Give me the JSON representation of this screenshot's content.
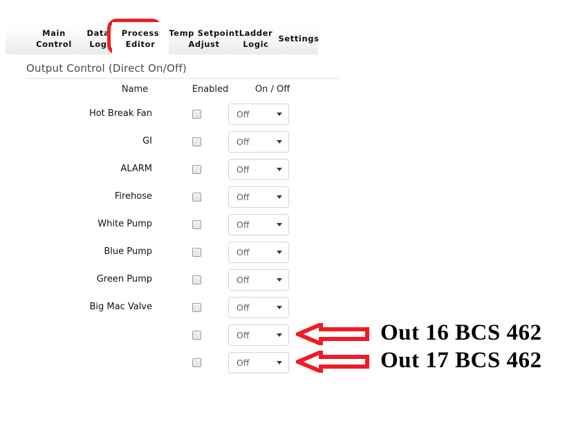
{
  "tabs": [
    {
      "id": "main",
      "line1": "Main",
      "line2": "Control",
      "name": "tab-main-control",
      "highlighted": false
    },
    {
      "id": "datalog",
      "line1": "Data",
      "line2": "Log",
      "name": "tab-data-log",
      "highlighted": false
    },
    {
      "id": "process",
      "line1": "Process",
      "line2": "Editor",
      "name": "tab-process-editor",
      "highlighted": true
    },
    {
      "id": "temp",
      "line1": "Temp Setpoint",
      "line2": "Adjust",
      "name": "tab-temp-setpoint-adjust",
      "highlighted": false
    },
    {
      "id": "ladder",
      "line1": "Ladder",
      "line2": "Logic",
      "name": "tab-ladder-logic",
      "highlighted": false
    },
    {
      "id": "settings",
      "line1": "Settings",
      "line2": "",
      "name": "tab-settings",
      "highlighted": false
    }
  ],
  "panel": {
    "title": "Output Control (Direct On/Off)"
  },
  "columns": {
    "name": "Name",
    "enabled": "Enabled",
    "onoff": "On / Off"
  },
  "rows": [
    {
      "name": "Hot Break Fan",
      "enabled": false,
      "state": "Off"
    },
    {
      "name": "GI",
      "enabled": false,
      "state": "Off"
    },
    {
      "name": "ALARM",
      "enabled": false,
      "state": "Off"
    },
    {
      "name": "Firehose",
      "enabled": false,
      "state": "Off"
    },
    {
      "name": "White Pump",
      "enabled": false,
      "state": "Off"
    },
    {
      "name": "Blue Pump",
      "enabled": false,
      "state": "Off"
    },
    {
      "name": "Green Pump",
      "enabled": false,
      "state": "Off"
    },
    {
      "name": "Big Mac Valve",
      "enabled": false,
      "state": "Off"
    },
    {
      "name": "",
      "enabled": false,
      "state": "Off"
    },
    {
      "name": "",
      "enabled": false,
      "state": "Off"
    }
  ],
  "annotations": [
    {
      "label": "Out 16  BCS 462",
      "arrow": "left-arrow-icon"
    },
    {
      "label": "Out 17  BCS 462",
      "arrow": "left-arrow-icon"
    }
  ],
  "colors": {
    "annotation_red": "#ee1c25",
    "highlight_red": "#ee1c25",
    "annotation_text": "#000000",
    "panel_title": "#4a4a4a"
  }
}
